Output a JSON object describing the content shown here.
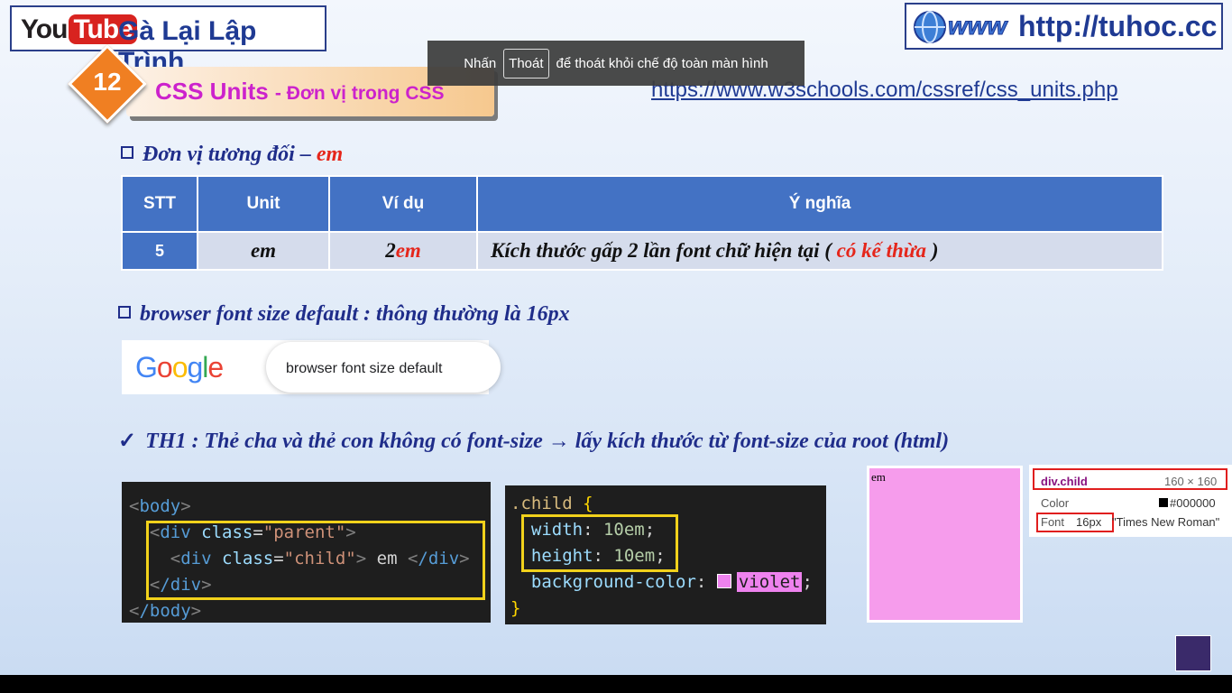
{
  "header": {
    "yt_you": "You",
    "yt_tube": "Tube",
    "channel_title": "Gà Lại Lập Trình",
    "site_url": "http://tuhoc.cc",
    "www_art": "www"
  },
  "toast": {
    "prefix": "Nhấn",
    "key": "Thoát",
    "suffix": "để thoát khỏi chế độ toàn màn hình"
  },
  "banner": {
    "number": "12",
    "title": "CSS Units",
    "subtitle": "- Đơn vị trong CSS",
    "ref_link": "https://www.w3schools.com/cssref/css_units.php"
  },
  "section1": {
    "label": "Đơn vị tương đối –",
    "accent": "em"
  },
  "table": {
    "headers": [
      "STT",
      "Unit",
      "Ví dụ",
      "Ý nghĩa"
    ],
    "row": {
      "stt": "5",
      "unit": "em",
      "example_num": "2",
      "example_unit": "em",
      "meaning_prefix": "Kích thước gấp 2 lần font chữ hiện tại (",
      "meaning_accent": "có kế thừa",
      "meaning_suffix": ")"
    }
  },
  "section2": {
    "label": "browser font size default : thông thường là 16px"
  },
  "google": {
    "logo_letters": [
      "G",
      "o",
      "o",
      "g",
      "l",
      "e"
    ],
    "query": "browser font size default"
  },
  "section3": {
    "check": "✓",
    "label_a": "TH1 : Thẻ cha và thẻ con không có font-size",
    "arrow": "→",
    "label_b": "lấy kích thước từ font-size của root (html)"
  },
  "html_code": {
    "body_open": "body",
    "div_tag": "div",
    "class_attr": "class",
    "parent_val": "\"parent\"",
    "child_val": "\"child\"",
    "child_text": " em ",
    "body_close": "/body",
    "div_close": "/div"
  },
  "css_code": {
    "selector": ".child",
    "open_brace": "{",
    "close_brace": "}",
    "width_prop": "width",
    "width_val": "10em",
    "height_prop": "height",
    "height_val": "10em",
    "bg_prop": "background-color",
    "bg_val": "violet"
  },
  "preview": {
    "text": "em"
  },
  "inspector": {
    "element": "div.child",
    "size": "160 × 160",
    "color_label": "Color",
    "color_value": "#000000",
    "font_label": "Font",
    "font_size": "16px",
    "font_family": "\"Times New Roman\""
  },
  "colors": {
    "header_blue": "#4372c4",
    "accent_red": "#e5261b",
    "banner_magenta": "#cc22cc",
    "violet": "#ee82ee",
    "highlight_yellow": "#f2d21b"
  }
}
